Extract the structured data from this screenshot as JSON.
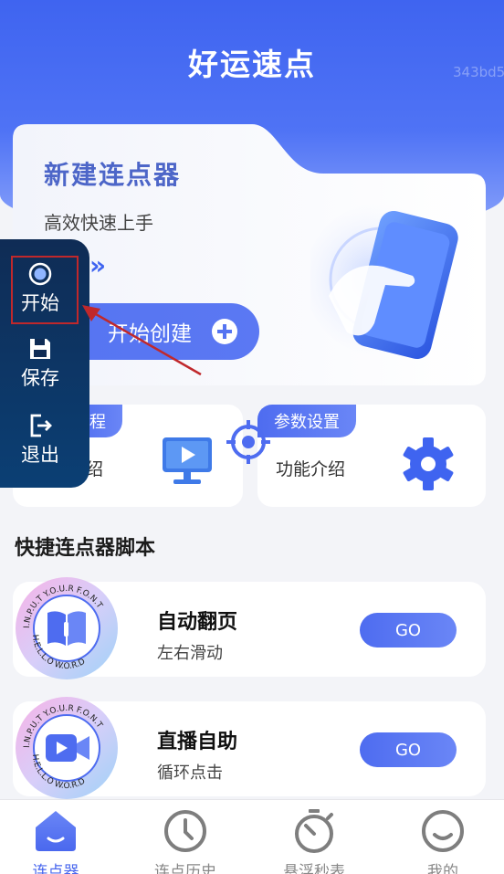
{
  "header": {
    "title": "好运速点",
    "watermark": "343bd5"
  },
  "create_card": {
    "title": "新建连点器",
    "subtitle": "高效快速上手",
    "chevrons": "»",
    "button_label": "开始创建"
  },
  "cards": [
    {
      "tag": "程",
      "text": "绍"
    },
    {
      "tag": "参数设置",
      "text": "功能介绍"
    }
  ],
  "section_title": "快捷连点器脚本",
  "scripts": [
    {
      "name": "自动翻页",
      "desc": "左右滑动",
      "go": "GO",
      "badge_top": "I.N.P.U.T Y.O.U.R F.O.N.T",
      "badge_bottom": "H.E.L.L.O W.O.R.D"
    },
    {
      "name": "直播自助",
      "desc": "循环点击",
      "go": "GO",
      "badge_top": "I.N.P.U.T Y.O.U.R F.O.N.T",
      "badge_bottom": "H.E.L.L.O W.O.R.D"
    }
  ],
  "float_panel": {
    "start": "开始",
    "save": "保存",
    "exit": "退出"
  },
  "tabs": [
    {
      "label": "连点器",
      "icon": "home-icon",
      "active": true
    },
    {
      "label": "连点历史",
      "icon": "clock-icon",
      "active": false
    },
    {
      "label": "悬浮秒表",
      "icon": "stopwatch-icon",
      "active": false
    },
    {
      "label": "我的",
      "icon": "profile-smile-icon",
      "active": false
    }
  ],
  "colors": {
    "accent": "#4a68ee",
    "panel": "#0f2c55",
    "highlight": "#c0282b"
  }
}
